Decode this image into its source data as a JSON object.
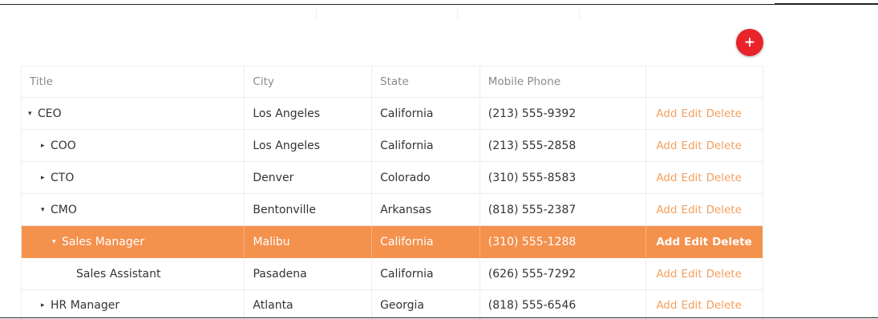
{
  "toolbar": {
    "add_icon": "+"
  },
  "table": {
    "headers": {
      "title": "Title",
      "city": "City",
      "state": "State",
      "phone": "Mobile Phone",
      "actions": ""
    },
    "action_labels": {
      "add": "Add",
      "edit": "Edit",
      "delete": "Delete"
    },
    "rows": [
      {
        "title": "CEO",
        "city": "Los Angeles",
        "state": "California",
        "phone": "(213) 555-9392",
        "toggle": "▾",
        "selected": false
      },
      {
        "title": "COO",
        "city": "Los Angeles",
        "state": "California",
        "phone": "(213) 555-2858",
        "toggle": "▸",
        "selected": false
      },
      {
        "title": "CTO",
        "city": "Denver",
        "state": "Colorado",
        "phone": "(310) 555-8583",
        "toggle": "▸",
        "selected": false
      },
      {
        "title": "CMO",
        "city": "Bentonville",
        "state": "Arkansas",
        "phone": "(818) 555-2387",
        "toggle": "▾",
        "selected": false
      },
      {
        "title": "Sales Manager",
        "city": "Malibu",
        "state": "California",
        "phone": "(310) 555-1288",
        "toggle": "▾",
        "selected": true
      },
      {
        "title": "Sales Assistant",
        "city": "Pasadena",
        "state": "California",
        "phone": "(626) 555-7292",
        "toggle": "",
        "selected": false
      },
      {
        "title": "HR Manager",
        "city": "Atlanta",
        "state": "Georgia",
        "phone": "(818) 555-6546",
        "toggle": "▸",
        "selected": false
      }
    ]
  },
  "colors": {
    "accent": "#f3914d",
    "action_link": "#f59f5c",
    "fab": "#e8232a"
  }
}
